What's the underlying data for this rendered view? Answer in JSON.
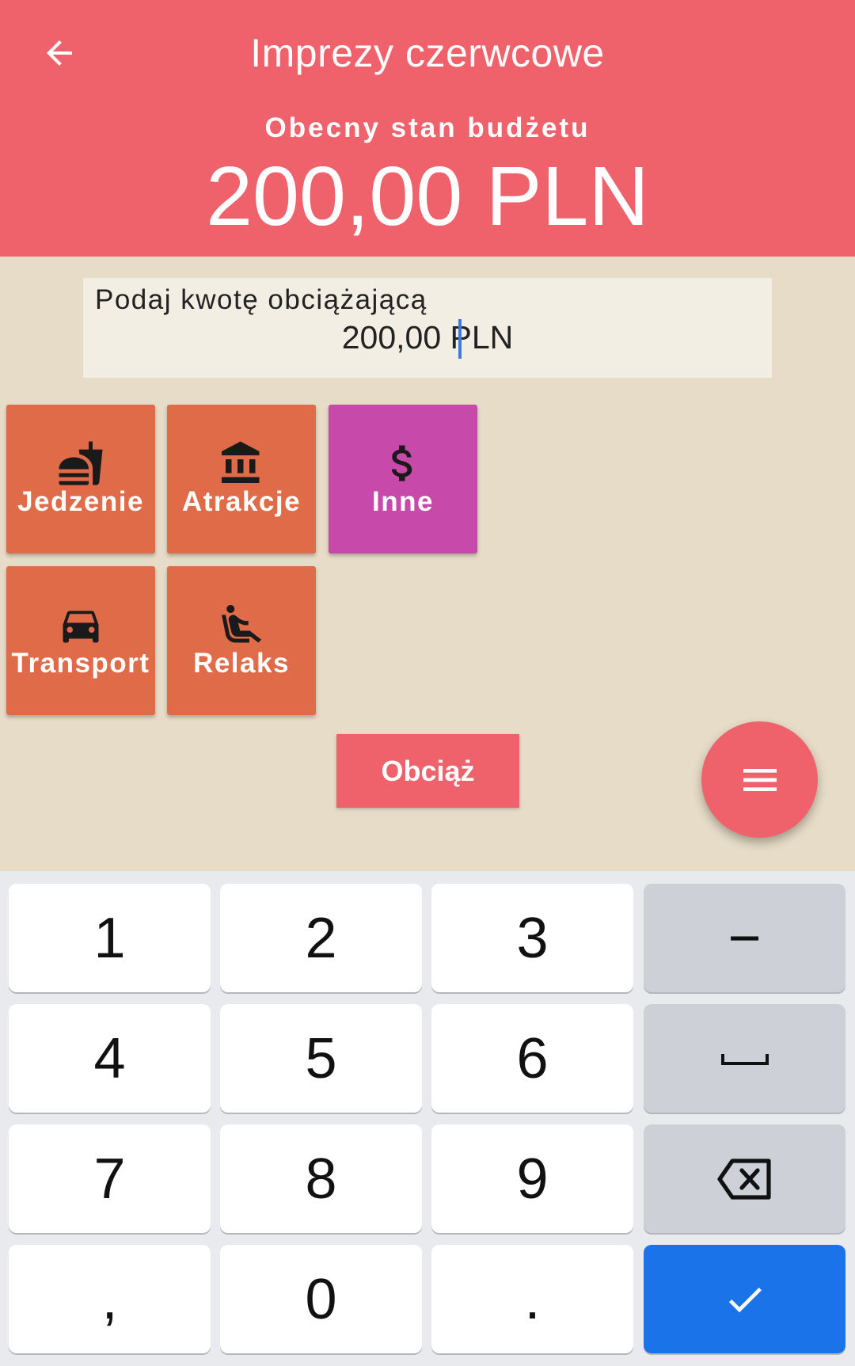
{
  "header": {
    "title": "Imprezy czerwcowe",
    "budget_label": "Obecny stan budżetu",
    "budget_value": "200,00 PLN",
    "color": "#ef626c"
  },
  "amount_input": {
    "label": "Podaj kwotę obciążającą",
    "value": "200,00 PLN"
  },
  "categories": [
    {
      "label": "Jedzenie",
      "icon": "fastfood-icon",
      "color": "#e06b48",
      "selected": false
    },
    {
      "label": "Atrakcje",
      "icon": "museum-icon",
      "color": "#e06b48",
      "selected": false
    },
    {
      "label": "Inne",
      "icon": "dollar-icon",
      "color": "#c74aab",
      "selected": true
    },
    {
      "label": "Transport",
      "icon": "car-icon",
      "color": "#e06b48",
      "selected": false
    },
    {
      "label": "Relaks",
      "icon": "seat-recline-icon",
      "color": "#e06b48",
      "selected": false
    }
  ],
  "charge_button": "Obciąż",
  "fab_icon": "menu-icon",
  "keyboard": {
    "keys": [
      "1",
      "2",
      "3",
      "−",
      "4",
      "5",
      "6",
      "space",
      "7",
      "8",
      "9",
      "backspace",
      ",",
      "0",
      ".",
      "done"
    ],
    "labels": {
      "k1": "1",
      "k2": "2",
      "k3": "3",
      "minus": "−",
      "k4": "4",
      "k5": "5",
      "k6": "6",
      "k7": "7",
      "k8": "8",
      "k9": "9",
      "comma": ",",
      "k0": "0",
      "dot": "."
    },
    "accent": "#1a73e8"
  }
}
